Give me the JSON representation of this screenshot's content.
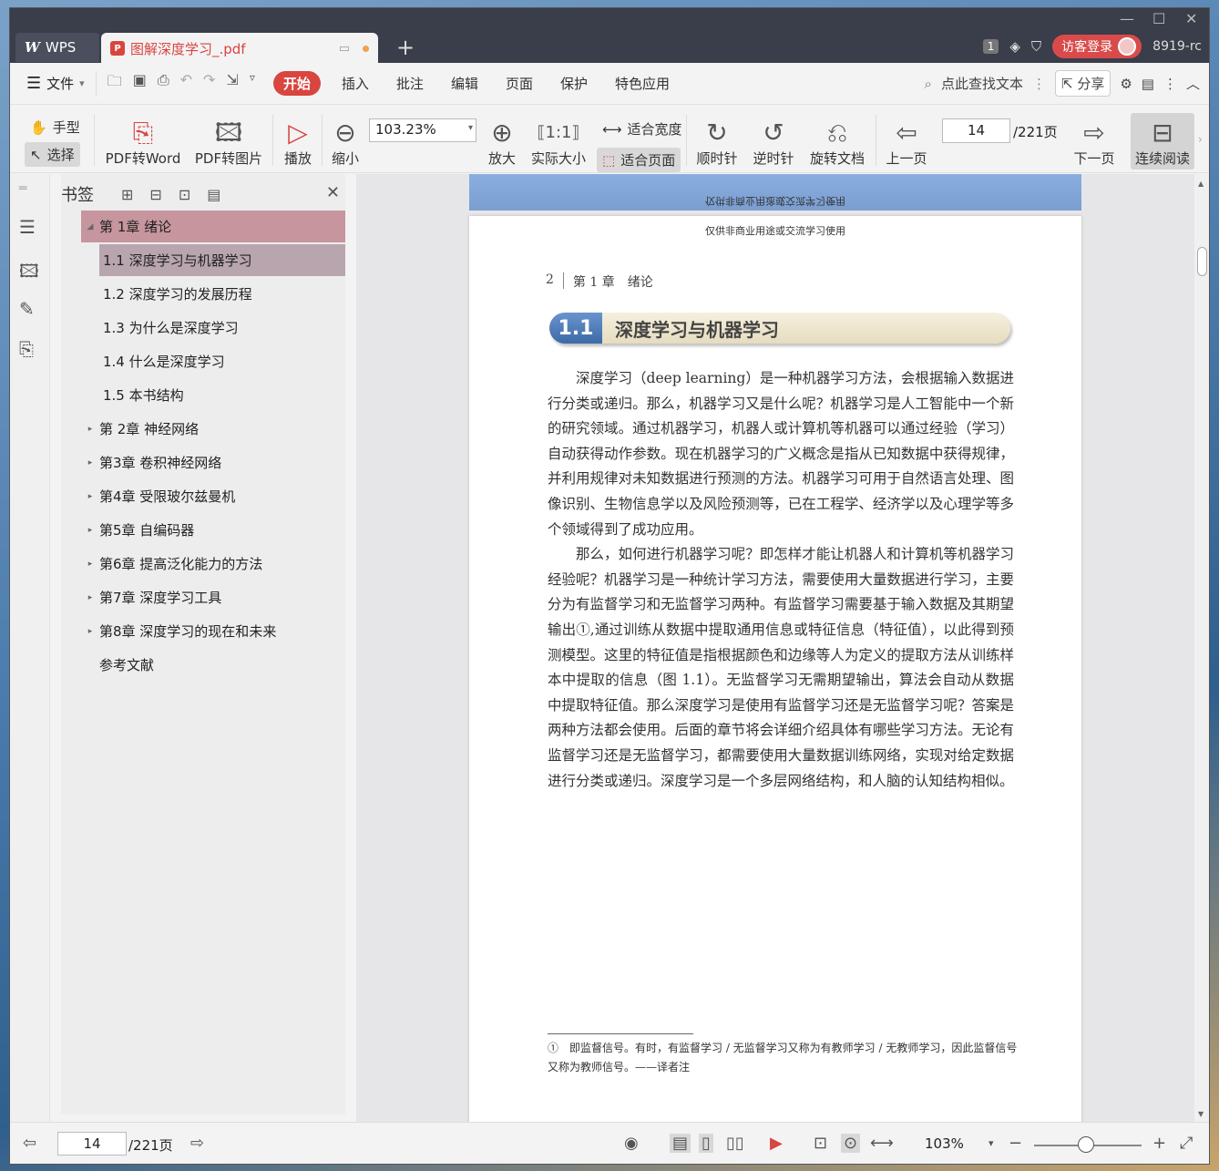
{
  "titlebar": {
    "app_label": "WPS",
    "doc_tab_title": "图解深度学习_.pdf",
    "page_count_badge": "1",
    "login_label": "访客登录",
    "user_name": "8919-rc"
  },
  "menubar": {
    "file": "文件",
    "start": "开始",
    "items": [
      "插入",
      "批注",
      "编辑",
      "页面",
      "保护",
      "特色应用"
    ],
    "search": "点此查找文本",
    "share": "分享"
  },
  "toolbar": {
    "hand": "手型",
    "select": "选择",
    "pdf_to_word": "PDF转Word",
    "pdf_to_image": "PDF转图片",
    "play": "播放",
    "zoom_out": "缩小",
    "zoom_value": "103.23%",
    "zoom_in": "放大",
    "actual_size": "实际大小",
    "fit_width": "适合宽度",
    "fit_page": "适合页面",
    "clockwise": "顺时针",
    "counter_clockwise": "逆时针",
    "rotate_doc": "旋转文档",
    "prev_page": "上一页",
    "page_value": "14",
    "page_total": "/221页",
    "next_page": "下一页",
    "continuous": "连续阅读"
  },
  "bookmarks": {
    "title": "书签",
    "items": [
      {
        "label": "第 1章 绪论",
        "level": 0,
        "expanded": true
      },
      {
        "label": "1.1 深度学习与机器学习",
        "level": 1
      },
      {
        "label": "1.2 深度学习的发展历程",
        "level": 1
      },
      {
        "label": "1.3 为什么是深度学习",
        "level": 1
      },
      {
        "label": "1.4 什么是深度学习",
        "level": 1
      },
      {
        "label": "1.5 本书结构",
        "level": 1
      },
      {
        "label": "第 2章 神经网络",
        "level": 0
      },
      {
        "label": "第3章 卷积神经网络",
        "level": 0
      },
      {
        "label": "第4章 受限玻尔兹曼机",
        "level": 0
      },
      {
        "label": "第5章 自编码器",
        "level": 0
      },
      {
        "label": "第6章 提高泛化能力的方法",
        "level": 0
      },
      {
        "label": "第7章 深度学习工具",
        "level": 0
      },
      {
        "label": "第8章 深度学习的现在和未来",
        "level": 0
      },
      {
        "label": "参考文献",
        "level": 0
      }
    ]
  },
  "page": {
    "prev_page_footer": "仅供非商业用途或交流学习使用",
    "top_note": "仅供非商业用途或交流学习使用",
    "page_number": "2",
    "chapter_head": "第 1 章　绪论",
    "section_number": "1.1",
    "section_title": "深度学习与机器学习",
    "paragraph1": "深度学习（deep learning）是一种机器学习方法，会根据输入数据进行分类或递归。那么，机器学习又是什么呢？机器学习是人工智能中一个新的研究领域。通过机器学习，机器人或计算机等机器可以通过经验（学习）自动获得动作参数。现在机器学习的广义概念是指从已知数据中获得规律，并利用规律对未知数据进行预测的方法。机器学习可用于自然语言处理、图像识别、生物信息学以及风险预测等，已在工程学、经济学以及心理学等多个领域得到了成功应用。",
    "paragraph2": "那么，如何进行机器学习呢？即怎样才能让机器人和计算机等机器学习经验呢？机器学习是一种统计学习方法，需要使用大量数据进行学习，主要分为有监督学习和无监督学习两种。有监督学习需要基于输入数据及其期望输出①,通过训练从数据中提取通用信息或特征信息（特征值），以此得到预测模型。这里的特征值是指根据颜色和边缘等人为定义的提取方法从训练样本中提取的信息（图 1.1）。无监督学习无需期望输出，算法会自动从数据中提取特征值。那么深度学习是使用有监督学习还是无监督学习呢？答案是两种方法都会使用。后面的章节将会详细介绍具体有哪些学习方法。无论有监督学习还是无监督学习，都需要使用大量数据训练网络，实现对给定数据进行分类或递归。深度学习是一个多层网络结构，和人脑的认知结构相似。",
    "footnote": "①　即监督信号。有时，有监督学习 / 无监督学习又称为有教师学习 / 无教师学习，因此监督信号又称为教师信号。——译者注"
  },
  "statusbar": {
    "page_value": "14",
    "page_total": "/221页",
    "zoom": "103%"
  }
}
